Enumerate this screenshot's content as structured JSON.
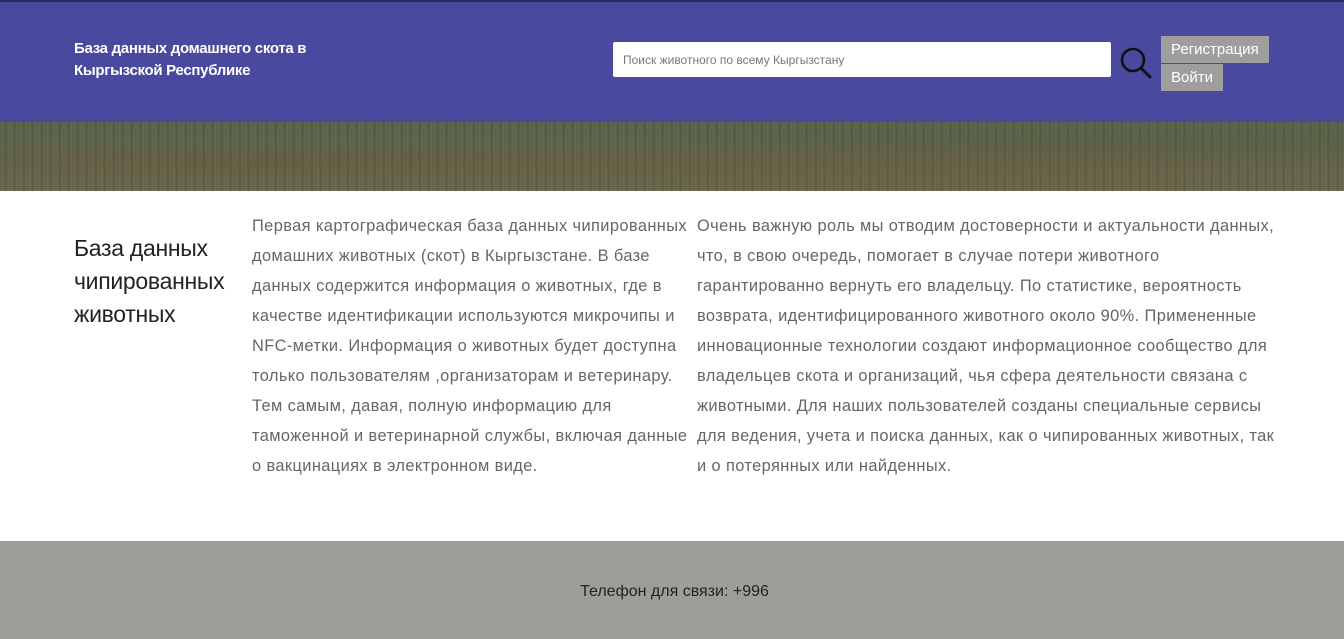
{
  "header": {
    "site_title": "База данных домашнего скота в Кыргызской Республике",
    "search_placeholder": "Поиск животного по всему Кыргызстану",
    "search_icon": "search-icon",
    "register_label": "Регистрация",
    "login_label": "Войти",
    "background_color": "#4a49a0"
  },
  "content": {
    "title": "База данных чипированных животных",
    "column1": "Первая картографическая база данных чипированных домашних животных (скот) в Кыргызстане. В базе данных содержится информация о животных, где в качестве идентификации используются микрочипы и NFC-метки. Информация о животных будет доступна только пользователям ,организаторам и ветеринару. Тем самым, давая, полную информацию для таможенной и ветеринарной службы, включая данные о вакцинациях в электронном виде.",
    "column2": "Очень важную роль мы отводим достоверности и актуальности данных, что, в свою очередь, помогает в случае потери животного гарантированно вернуть его владельцу. По статистике, вероятность возврата, идентифицированного животного около 90%. Примененные инновационные технологии создают информационное сообщество для владельцев скота и организаций, чья сфера деятельности связана с животными. Для наших пользователей созданы специальные сервисы для ведения, учета и поиска данных, как о чипированных животных, так и о потерянных или найденных."
  },
  "footer": {
    "phone_text": "Телефон для связи: +996",
    "background_color": "#9e9d99"
  }
}
